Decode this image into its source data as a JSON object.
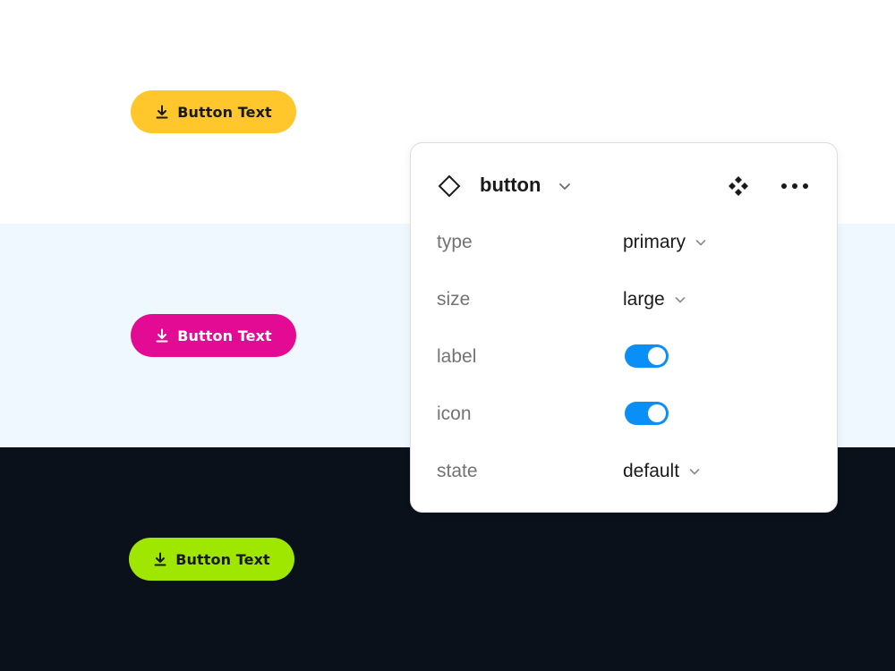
{
  "demo_buttons": [
    {
      "label": "Button Text",
      "icon": "download-icon",
      "background": "#ffc72c",
      "text_color": "#1a1a1a",
      "section_background": "#ffffff"
    },
    {
      "label": "Button Text",
      "icon": "download-icon",
      "background": "#e30b94",
      "text_color": "#ffffff",
      "section_background": "#eef8fe"
    },
    {
      "label": "Button Text",
      "icon": "download-icon",
      "background": "#9fe600",
      "text_color": "#1a1a1a",
      "section_background": "#0b111a"
    }
  ],
  "panel": {
    "component_icon": "diamond-outline-icon",
    "component_name": "button",
    "header_icons": [
      "chevron-down-icon",
      "variants-icon",
      "more-horizontal-icon"
    ],
    "properties": [
      {
        "name": "type",
        "kind": "dropdown",
        "value": "primary"
      },
      {
        "name": "size",
        "kind": "dropdown",
        "value": "large"
      },
      {
        "name": "label",
        "kind": "toggle",
        "value": true
      },
      {
        "name": "icon",
        "kind": "toggle",
        "value": true
      },
      {
        "name": "state",
        "kind": "dropdown",
        "value": "default"
      }
    ],
    "toggle_on_color": "#0a8ff6"
  }
}
